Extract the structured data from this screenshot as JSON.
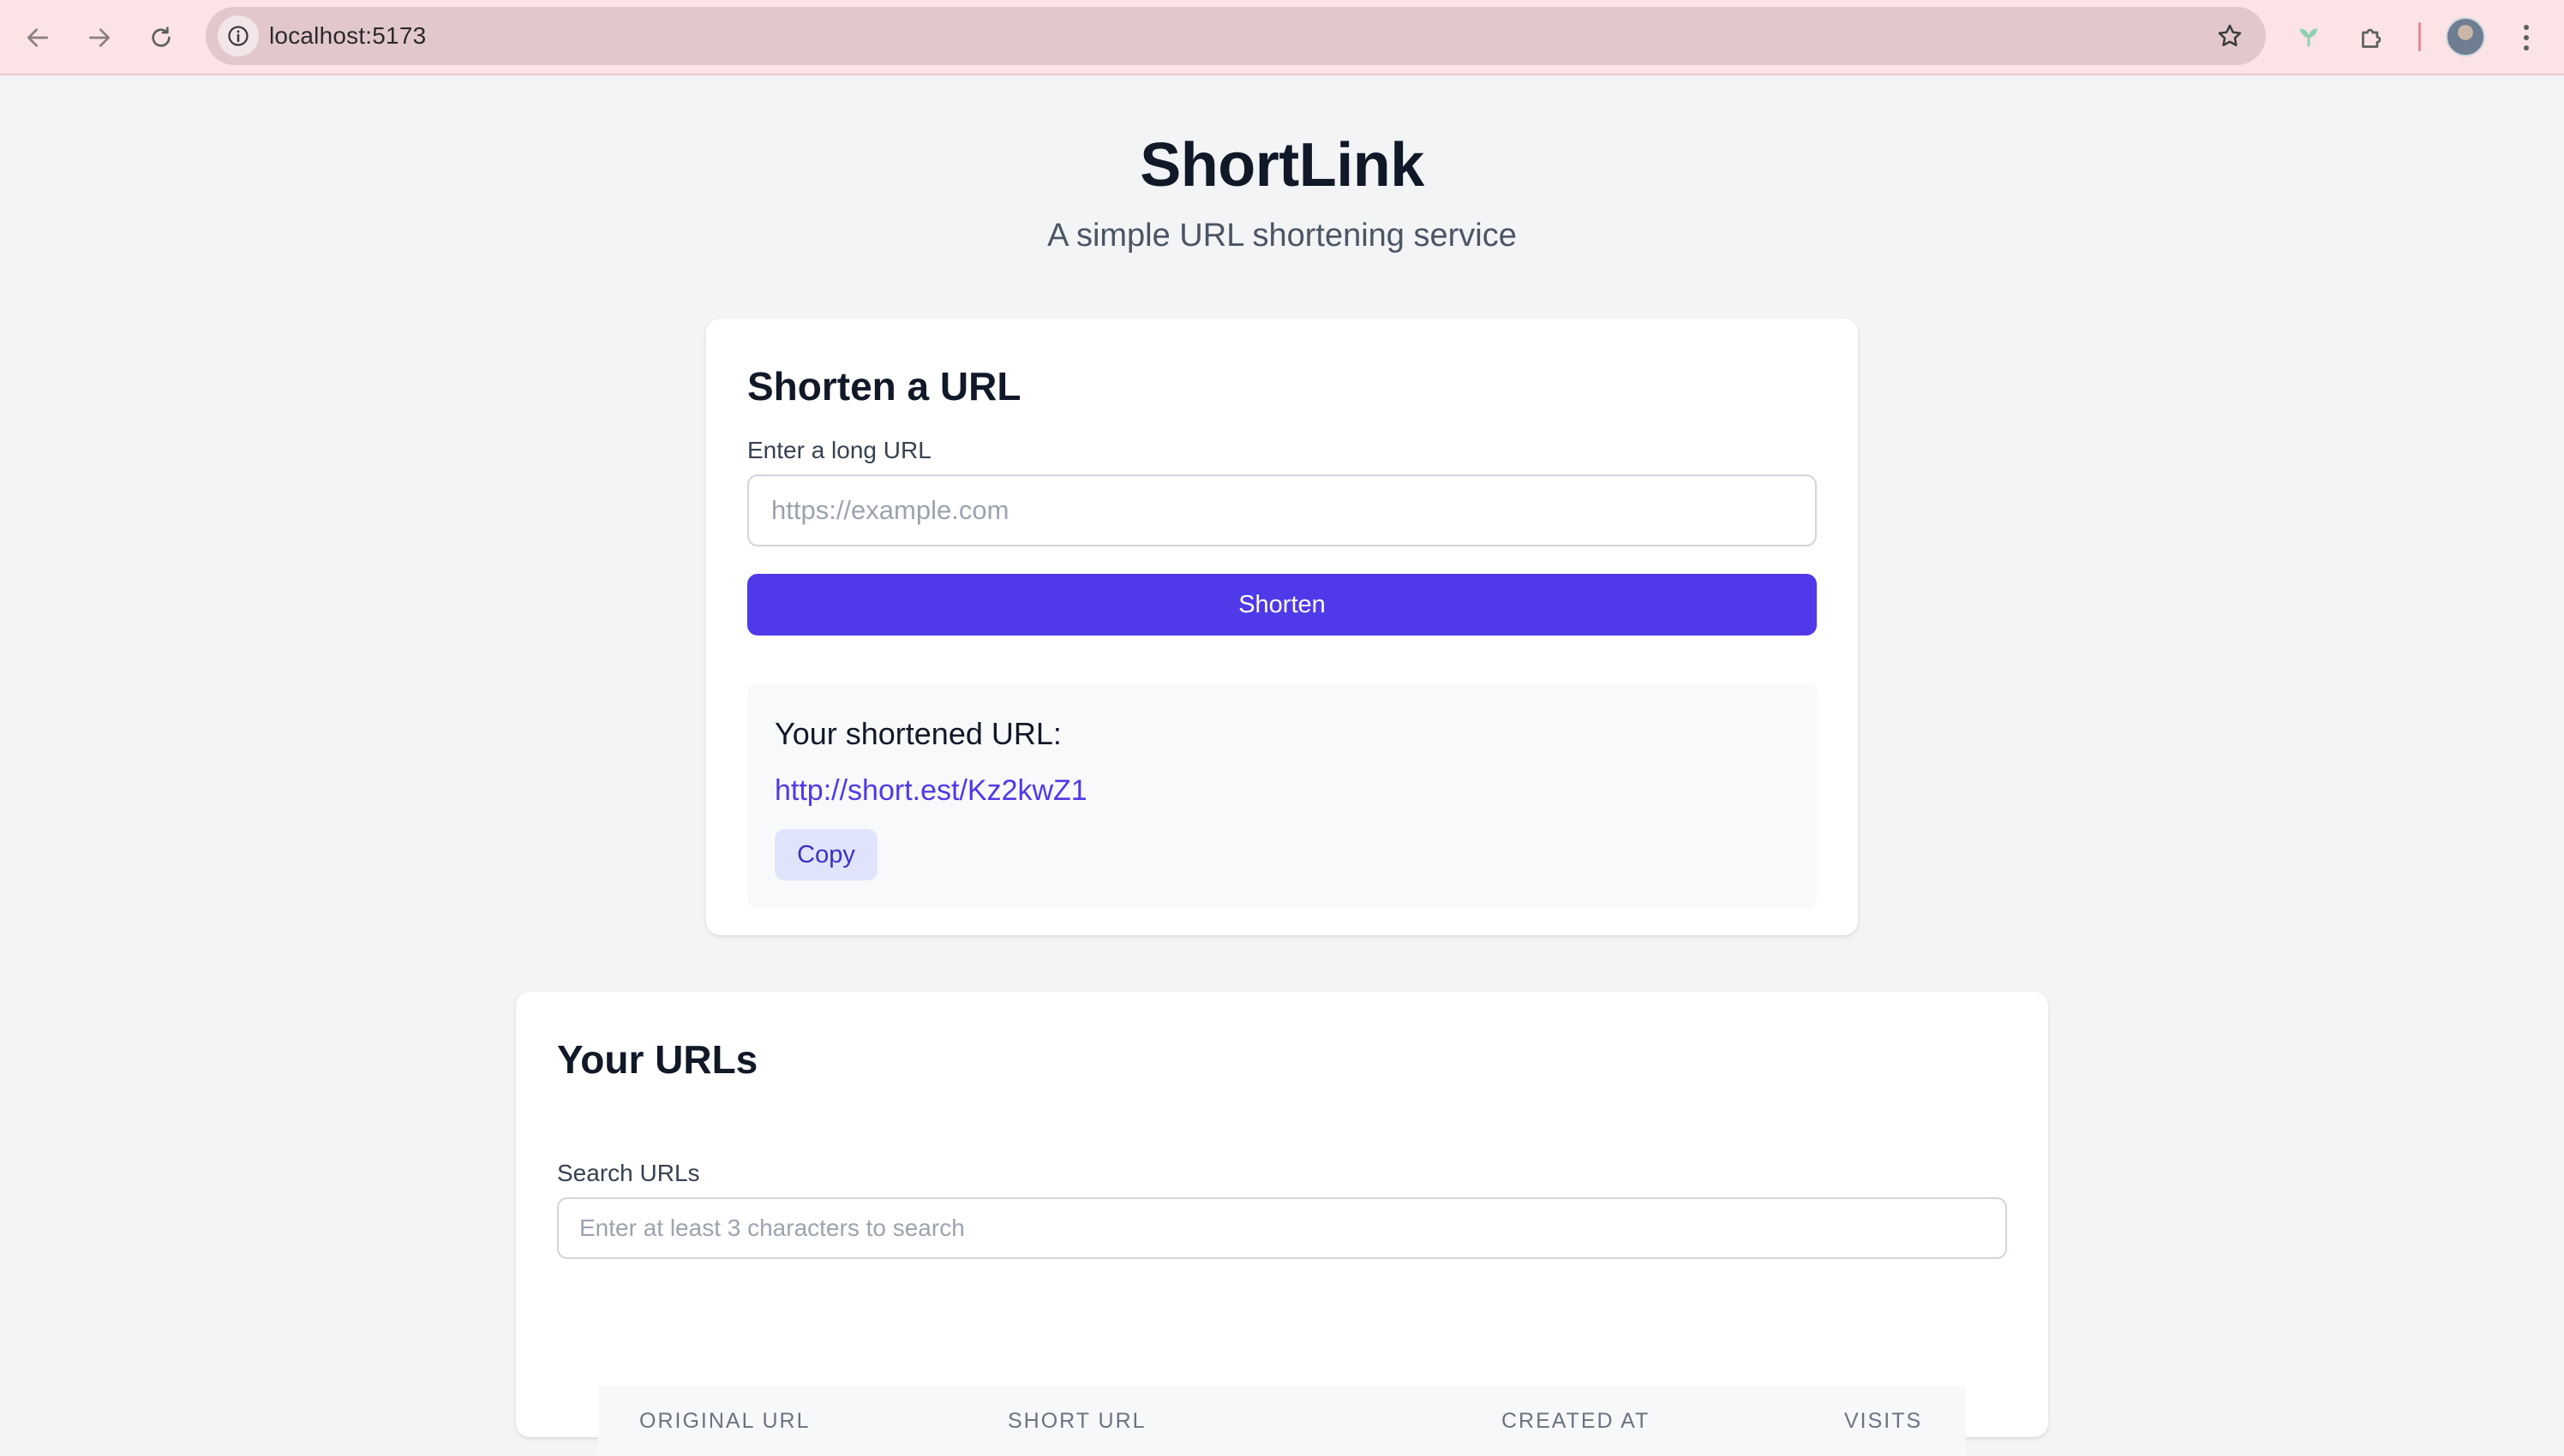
{
  "browser": {
    "url": "localhost:5173",
    "icons": [
      "back-arrow-icon",
      "forward-arrow-icon",
      "reload-icon",
      "site-info-icon",
      "star-icon",
      "extension-icon",
      "puzzle-icon",
      "profile-avatar",
      "menu-icon"
    ]
  },
  "header": {
    "title": "ShortLink",
    "subtitle": "A simple URL shortening service"
  },
  "shorten_card": {
    "title": "Shorten a URL",
    "input_label": "Enter a long URL",
    "input_placeholder": "https://example.com",
    "input_value": "",
    "submit_label": "Shorten",
    "result": {
      "heading": "Your shortened URL:",
      "short_url": "http://short.est/Kz2kwZ1",
      "copy_label": "Copy"
    }
  },
  "urls_card": {
    "title": "Your URLs",
    "search_label": "Search URLs",
    "search_placeholder": "Enter at least 3 characters to search",
    "search_value": "",
    "columns": [
      "ORIGINAL URL",
      "SHORT URL",
      "CREATED AT",
      "VISITS"
    ]
  },
  "colors": {
    "accent": "#4f39e8",
    "chrome_bg": "#fbe3e6",
    "page_bg": "#f3f4f6",
    "copy_bg": "#e0e4fb"
  }
}
